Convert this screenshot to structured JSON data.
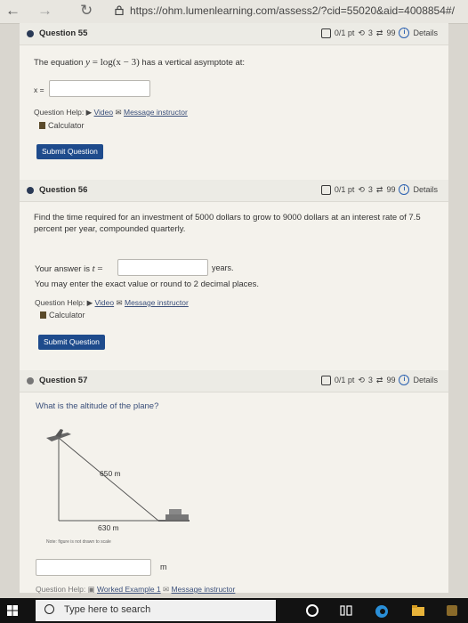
{
  "browser": {
    "url": "https://ohm.lumenlearning.com/assess2/?cid=55020&aid=4008854#/"
  },
  "q55": {
    "title": "Question 55",
    "points": "0/1 pt",
    "retries": "3",
    "attempts": "99",
    "details": "Details",
    "prompt_prefix": "The equation ",
    "prompt_var": "y",
    "prompt_eq": " = log(x − 3)",
    "prompt_suffix": " has a vertical asymptote at:",
    "answer_label": "x =",
    "answer_value": "",
    "help_label": "Question Help:",
    "video": "Video",
    "message": "Message instructor",
    "calculator": "Calculator",
    "submit": "Submit Question"
  },
  "q56": {
    "title": "Question 56",
    "points": "0/1 pt",
    "retries": "3",
    "attempts": "99",
    "details": "Details",
    "prompt": "Find the time required for an investment of 5000 dollars to grow to 9000 dollars at an interest rate of 7.5 percent per year, compounded quarterly.",
    "answer_prefix": "Your answer is ",
    "answer_var": "t",
    "answer_eq": " =",
    "answer_value": "",
    "answer_unit": "years.",
    "hint": "You may enter the exact value or round to 2 decimal places.",
    "help_label": "Question Help:",
    "video": "Video",
    "message": "Message instructor",
    "calculator": "Calculator",
    "submit": "Submit Question"
  },
  "q57": {
    "title": "Question 57",
    "points": "0/1 pt",
    "retries": "3",
    "attempts": "99",
    "details": "Details",
    "prompt": "What is the altitude of the plane?",
    "label_hyp": "650 m",
    "label_base": "630 m",
    "note": "Note: figure is not drawn to scale",
    "answer_value": "",
    "answer_unit": "m",
    "help_label": "Question Help:",
    "worked": "Worked Example 1",
    "message": "Message instructor"
  },
  "taskbar": {
    "search_placeholder": "Type here to search"
  },
  "colors": {
    "accent": "#1e4b8c",
    "link": "#3a4f7a"
  }
}
